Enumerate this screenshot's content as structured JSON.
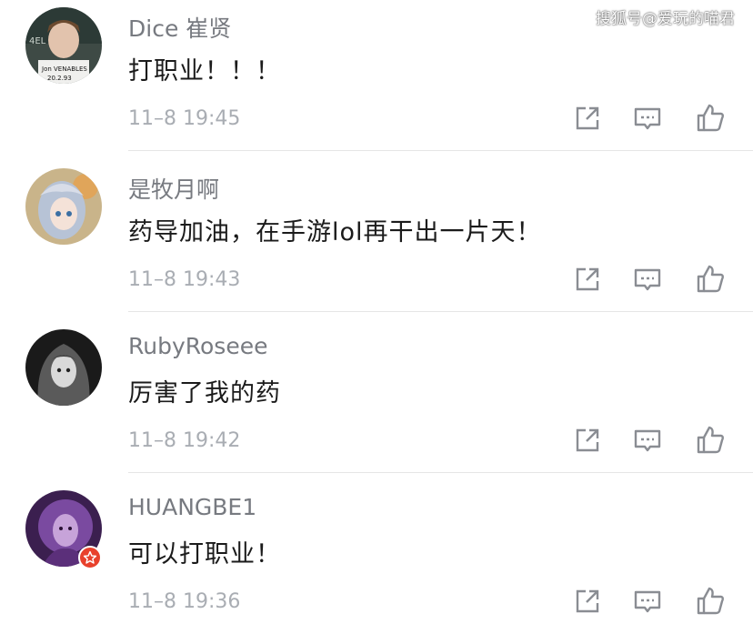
{
  "watermark": "搜狐号@爱玩的喵君",
  "comments": [
    {
      "username": "Dice 崔贤",
      "text": "打职业！！！",
      "time": "11–8 19:45",
      "avatar": "avatar-boy-classroom"
    },
    {
      "username": "是牧月啊",
      "text": "药导加油，在手游lol再干出一片天！",
      "time": "11–8 19:43",
      "avatar": "avatar-anime-girl"
    },
    {
      "username": "RubyRoseee",
      "text": "厉害了我的药",
      "time": "11–8 19:42",
      "avatar": "avatar-dark-anime-girl"
    },
    {
      "username": "HUANGBE1",
      "text": "可以打职业！",
      "time": "11–8 19:36",
      "avatar": "avatar-purple-figure",
      "badge": "star-badge-icon"
    }
  ],
  "icons": {
    "share": "share-icon",
    "reply": "comment-icon",
    "like": "thumbs-up-icon"
  },
  "colors": {
    "username": "#777a80",
    "text": "#1b1b1b",
    "time": "#a9adb3",
    "badge": "#e8412c"
  }
}
